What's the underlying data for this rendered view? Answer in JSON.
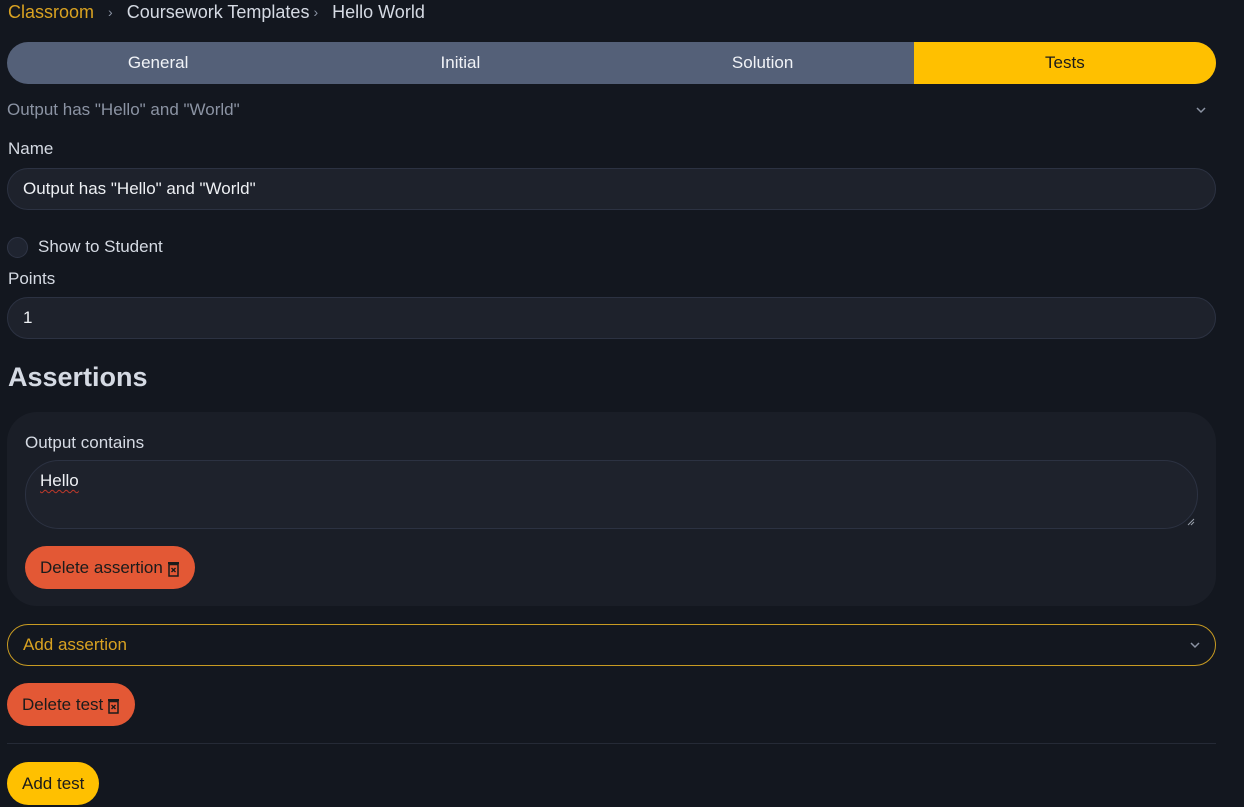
{
  "breadcrumb": {
    "items": [
      "Classroom",
      "Coursework Templates",
      "Hello World"
    ]
  },
  "tabs": [
    {
      "label": "General",
      "active": false
    },
    {
      "label": "Initial",
      "active": false
    },
    {
      "label": "Solution",
      "active": false
    },
    {
      "label": "Tests",
      "active": true
    }
  ],
  "test": {
    "header": "Output has \"Hello\" and \"World\"",
    "name_label": "Name",
    "name_value": "Output has \"Hello\" and \"World\"",
    "show_to_student_label": "Show to Student",
    "show_to_student_checked": false,
    "points_label": "Points",
    "points_value": "1",
    "assertions_title": "Assertions",
    "assertions": [
      {
        "type_label": "Output contains",
        "value": "Hello",
        "delete_label": "Delete assertion"
      }
    ],
    "add_assertion_label": "Add assertion",
    "delete_test_label": "Delete test"
  },
  "add_test_label": "Add test",
  "colors": {
    "accent": "#ffc000",
    "danger": "#e35835",
    "background": "#13171f",
    "tab_bg": "#546078"
  }
}
